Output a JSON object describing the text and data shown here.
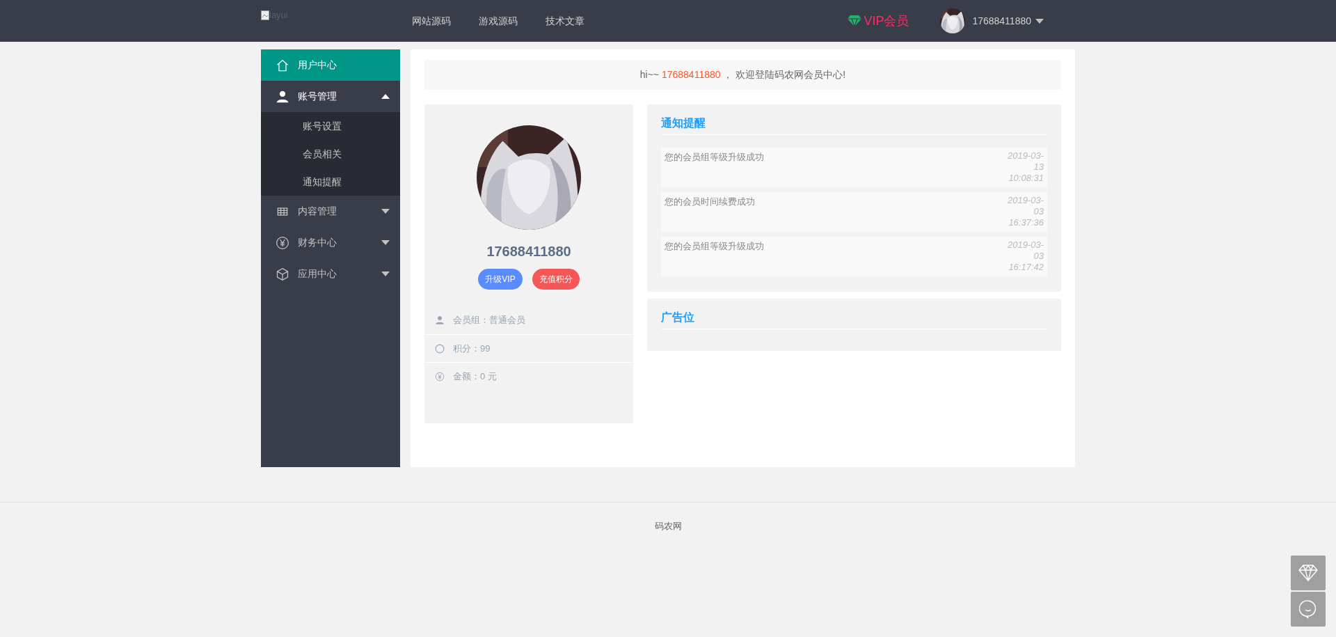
{
  "header": {
    "logo_alt": "layui",
    "nav": [
      "网站源码",
      "游戏源码",
      "技术文章"
    ],
    "vip": "VIP会员",
    "user": "17688411880"
  },
  "sidebar": {
    "items": [
      {
        "kind": "link",
        "label": "用户中心",
        "selected": true
      },
      {
        "kind": "group",
        "label": "账号管理",
        "selected": false,
        "expanded": true,
        "children": [
          {
            "label": "账号设置"
          },
          {
            "label": "会员相关"
          },
          {
            "label": "通知提醒"
          }
        ]
      },
      {
        "kind": "group",
        "label": "内容管理",
        "selected": false,
        "expanded": false
      },
      {
        "kind": "group",
        "label": "财务中心",
        "selected": false,
        "expanded": false
      },
      {
        "kind": "group",
        "label": "应用中心",
        "selected": false,
        "expanded": false
      }
    ]
  },
  "welcome": {
    "prefix": "hi~~",
    "name": "17688411880",
    "suffix": "， 欢迎登陆码农网会员中心!"
  },
  "profile": {
    "username": "17688411880",
    "buttons": [
      {
        "label": "升级VIP",
        "color": "#5a8bff"
      },
      {
        "label": "充值积分",
        "color": "#f55656"
      }
    ],
    "info": [
      {
        "kind": "group",
        "text": "会员组：普通会员"
      },
      {
        "kind": "points",
        "text": "积分：99"
      },
      {
        "kind": "money",
        "text": "金额：0 元"
      }
    ]
  },
  "notices": {
    "title": "通知提醒",
    "items": [
      {
        "text": "您的会员组等级升级成功",
        "time": "2019-03-13 10:08:31"
      },
      {
        "text": "您的会员时间续费成功",
        "time": "2019-03-03 16:37:36"
      },
      {
        "text": "您的会员组等级升级成功",
        "time": "2019-03-03 16:17:42"
      }
    ]
  },
  "ad": {
    "title": "广告位"
  },
  "footer": {
    "text": "码农网"
  }
}
